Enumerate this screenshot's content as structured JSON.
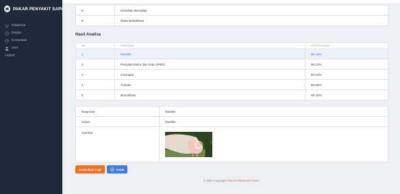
{
  "brand": {
    "name": "PAKAR PENYAKIT SAPI",
    "icon": "cow-logo-icon"
  },
  "nav": [
    {
      "label": "Diagnosa",
      "icon": "stethoscope-icon"
    },
    {
      "label": "Gejala",
      "icon": "clock-icon"
    },
    {
      "label": "Konsultasi",
      "icon": "clock-icon"
    },
    {
      "label": "user",
      "icon": "user-icon"
    },
    {
      "label": "Logout",
      "icon": ""
    }
  ],
  "top_rows": [
    {
      "no": "8",
      "gejala": "Kesulitan Bernafas"
    },
    {
      "no": "9",
      "gejala": "Diare Berlebihan"
    }
  ],
  "section_title": "Hasil Analisa",
  "results": {
    "headers": [
      "NO.",
      "DIAGNOSA",
      "KEPERCAYAAN"
    ],
    "rows": [
      {
        "no": "1",
        "diagnosa": "Mastitis",
        "kepercayaan": "96.43%"
      },
      {
        "no": "2",
        "diagnosa": "Penyakit Mulut dan Kuku (PMK)",
        "kepercayaan": "96.22%"
      },
      {
        "no": "3",
        "diagnosa": "Cacingan",
        "kepercayaan": "93.53%"
      },
      {
        "no": "4",
        "diagnosa": "Antraks",
        "kepercayaan": "89.58%"
      },
      {
        "no": "5",
        "diagnosa": "Brucellosis",
        "kepercayaan": "89.42%"
      }
    ]
  },
  "detail": {
    "diagnosa_label": "Diagnosa",
    "diagnosa_value": "Mastitis",
    "solusi_label": "Solusi",
    "solusi_value": "Mastitis",
    "gambar_label": "Gambar"
  },
  "buttons": {
    "konsultasi": "Konsultasi Lagi",
    "cetak": "Cetak"
  },
  "footer": {
    "prefix": "© 2024 Copyright:",
    "brand": "PAKAR PENYAKIT SAPI"
  },
  "colors": {
    "sidebar": "#1f2838",
    "accent_orange": "#f26f21",
    "accent_blue": "#3d7be0",
    "highlight_row": "#eef1f9"
  }
}
